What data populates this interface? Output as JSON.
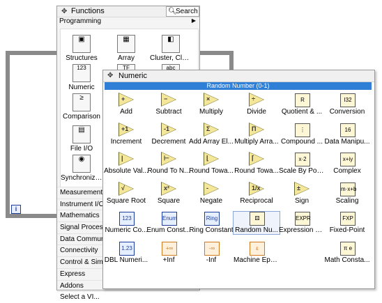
{
  "functions_palette": {
    "title": "Functions",
    "search_label": "Search",
    "category": "Programming",
    "icons": [
      {
        "label": "Structures",
        "glyph": "▣"
      },
      {
        "label": "Array",
        "glyph": "▦"
      },
      {
        "label": "Cluster, Clas...",
        "glyph": "◧"
      },
      {
        "label": "Numeric",
        "glyph": "123"
      },
      {
        "label": "",
        "glyph": "TF"
      },
      {
        "label": "",
        "glyph": "abc"
      },
      {
        "label": "Comparison",
        "glyph": "≥"
      },
      {
        "label": "File I/O",
        "glyph": "▤"
      },
      {
        "label": "Synchronizat...",
        "glyph": "◉"
      }
    ],
    "categories": [
      "Measurement I...",
      "Instrument I/O",
      "Mathematics",
      "Signal Processi...",
      "Data Communi...",
      "Connectivity",
      "Control & Simu...",
      "Express",
      "Addons",
      "Select a VI..."
    ]
  },
  "loop": {
    "iteration_label": "i"
  },
  "numeric_palette": {
    "title": "Numeric",
    "highlight_tip": "Random Number (0-1)",
    "items": [
      {
        "label": "Add",
        "glyph": "+"
      },
      {
        "label": "Subtract",
        "glyph": "−"
      },
      {
        "label": "Multiply",
        "glyph": "×"
      },
      {
        "label": "Divide",
        "glyph": "÷"
      },
      {
        "label": "Quotient & ...",
        "glyph": "R"
      },
      {
        "label": "Conversion",
        "glyph": "I32"
      },
      {
        "label": "Increment",
        "glyph": "+1"
      },
      {
        "label": "Decrement",
        "glyph": "-1"
      },
      {
        "label": "Add Array El...",
        "glyph": "Σ"
      },
      {
        "label": "Multiply Arra...",
        "glyph": "Π"
      },
      {
        "label": "Compound ...",
        "glyph": "⋮"
      },
      {
        "label": "Data Manipu...",
        "glyph": "16"
      },
      {
        "label": "Absolute Val...",
        "glyph": "|"
      },
      {
        "label": "Round To N...",
        "glyph": "⊢"
      },
      {
        "label": "Round Towa...",
        "glyph": "⌊"
      },
      {
        "label": "Round Towa...",
        "glyph": "⌈"
      },
      {
        "label": "Scale By Pow...",
        "glyph": "x·2"
      },
      {
        "label": "Complex",
        "glyph": "x+iy"
      },
      {
        "label": "Square Root",
        "glyph": "√"
      },
      {
        "label": "Square",
        "glyph": "x²"
      },
      {
        "label": "Negate",
        "glyph": "-"
      },
      {
        "label": "Reciprocal",
        "glyph": "1/x"
      },
      {
        "label": "Sign",
        "glyph": "±"
      },
      {
        "label": "Scaling",
        "glyph": "m·x+b"
      },
      {
        "label": "Numeric Co...",
        "glyph": "123"
      },
      {
        "label": "Enum Const...",
        "glyph": "Enum"
      },
      {
        "label": "Ring Constant",
        "glyph": "Ring"
      },
      {
        "label": "Random Nu...",
        "glyph": "⚄"
      },
      {
        "label": "Expression N...",
        "glyph": "EXPR"
      },
      {
        "label": "Fixed-Point",
        "glyph": "FXP"
      },
      {
        "label": "DBL Numeri...",
        "glyph": "1.23"
      },
      {
        "label": "+Inf",
        "glyph": "+∞"
      },
      {
        "label": "-Inf",
        "glyph": "-∞"
      },
      {
        "label": "Machine Eps...",
        "glyph": "ε"
      },
      {
        "label": "",
        "glyph": ""
      },
      {
        "label": "Math Consta...",
        "glyph": "π e"
      }
    ]
  }
}
